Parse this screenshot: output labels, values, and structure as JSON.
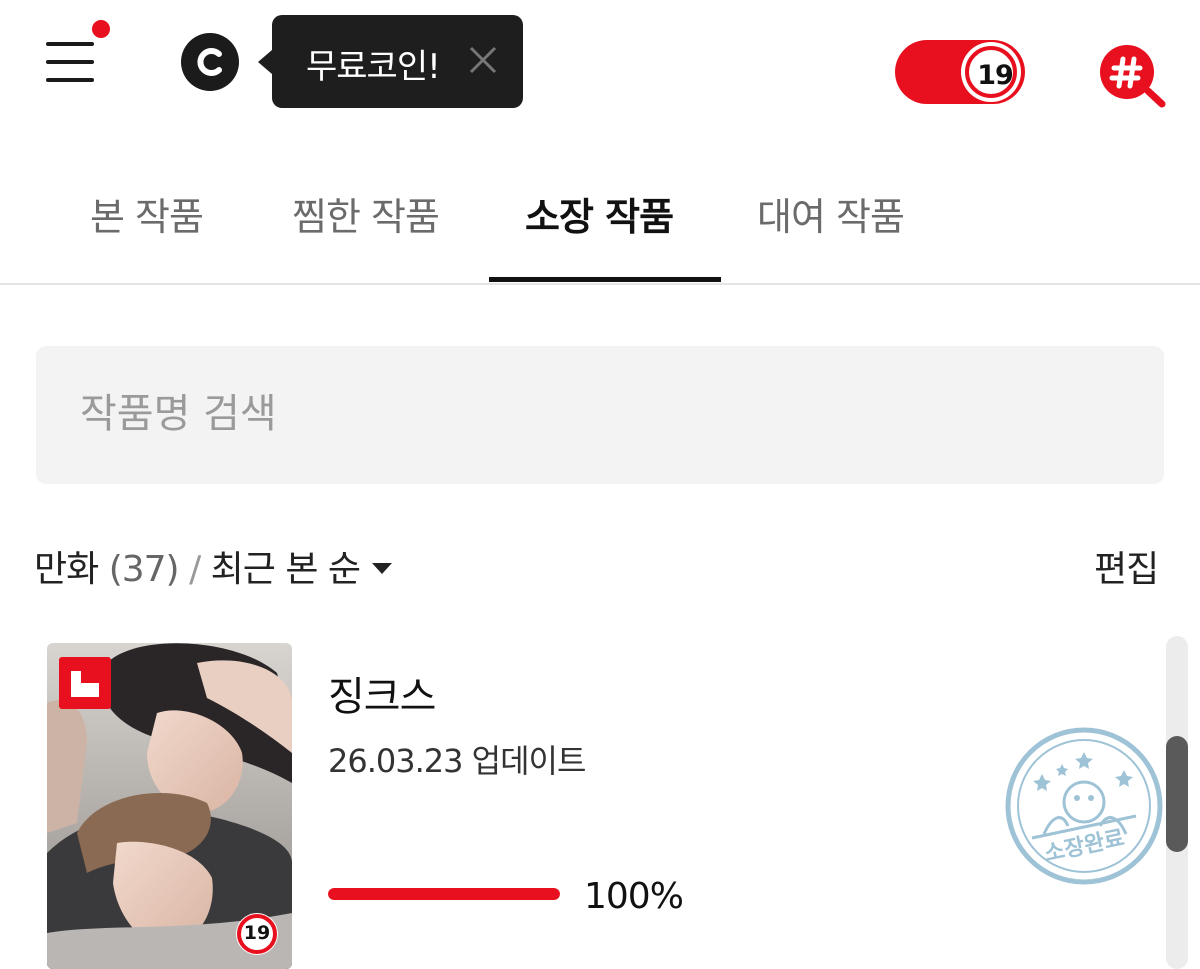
{
  "header": {
    "tooltip_text": "무료코인!",
    "adult_toggle_label": "19",
    "adult_toggle_on": true
  },
  "tabs": [
    {
      "label": "본 작품",
      "active": false
    },
    {
      "label": "찜한 작품",
      "active": false
    },
    {
      "label": "소장 작품",
      "active": true
    },
    {
      "label": "대여 작품",
      "active": false
    }
  ],
  "search": {
    "placeholder": "작품명 검색",
    "value": ""
  },
  "filter": {
    "category": "만화",
    "count": "(37)",
    "separator": "/",
    "sort": "최근 본 순",
    "edit_label": "편집"
  },
  "items": [
    {
      "title": "징크스",
      "date": "26.03.23",
      "update_label": "업데이트",
      "progress_text": "100%",
      "progress_fraction": 1.0,
      "age_badge": "19",
      "stamp_text": "소장완료"
    }
  ],
  "colors": {
    "accent": "#e8101e",
    "dark": "#1e1e1e",
    "stamp": "#9fc3d6"
  },
  "icons": {
    "menu": "menu-icon",
    "coin": "coin-icon",
    "close": "close-icon",
    "hash_search": "hashtag-search-icon",
    "sort": "caret-down-icon"
  }
}
